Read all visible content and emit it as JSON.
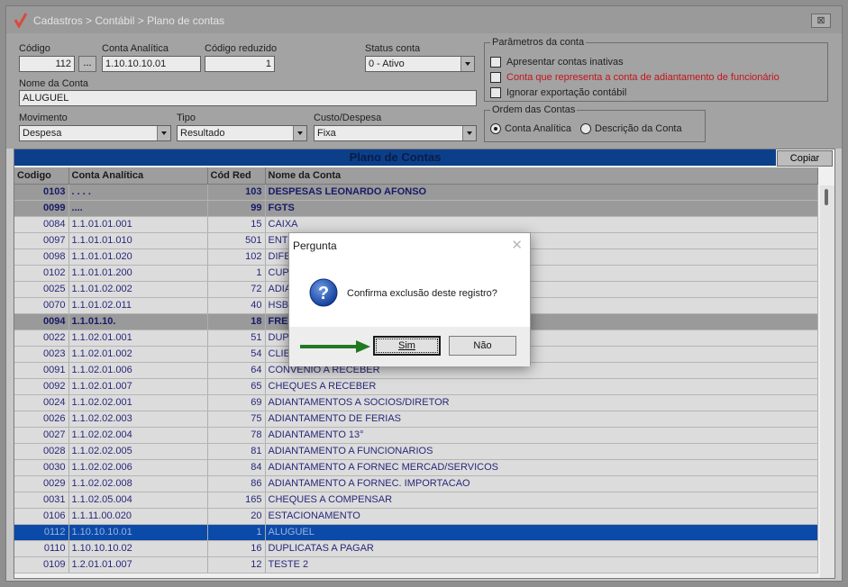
{
  "window": {
    "breadcrumb": "Cadastros > Contábil > Plano de contas",
    "close_label": "⊠"
  },
  "form": {
    "codigo_label": "Código",
    "codigo_value": "112",
    "dots_label": "...",
    "conta_analitica_label": "Conta Analítica",
    "conta_analitica_value": "1.10.10.10.01",
    "codigo_reduzido_label": "Código reduzido",
    "codigo_reduzido_value": "1",
    "status_label": "Status conta",
    "status_value": "0 - Ativo",
    "nome_label": "Nome da Conta",
    "nome_value": "ALUGUEL",
    "movimento_label": "Movimento",
    "movimento_value": "Despesa",
    "tipo_label": "Tipo",
    "tipo_value": "Resultado",
    "custo_label": "Custo/Despesa",
    "custo_value": "Fixa"
  },
  "parametros": {
    "title": "Parâmetros da conta",
    "opt1": "Apresentar contas inativas",
    "opt2": "Conta que representa a conta de adiantamento de funcionário",
    "opt3": "Ignorar exportação contábil"
  },
  "ordem": {
    "title": "Ordem das Contas",
    "opt1": "Conta Analítica",
    "opt2": "Descrição da Conta"
  },
  "grid": {
    "title": "Plano de Contas",
    "copy_label": "Copiar",
    "headers": [
      "Codigo",
      "Conta Analítica",
      "Cód Red",
      "Nome da Conta"
    ],
    "rows": [
      {
        "c": "0103",
        "a": ". . . .",
        "r": "103",
        "n": "DESPESAS LEONARDO AFONSO",
        "t": "grp"
      },
      {
        "c": "0099",
        "a": "....",
        "r": "99",
        "n": "FGTS",
        "t": "grp"
      },
      {
        "c": "0084",
        "a": "1.1.01.01.001",
        "r": "15",
        "n": "CAIXA",
        "t": ""
      },
      {
        "c": "0097",
        "a": "1.1.01.01.010",
        "r": "501",
        "n": "ENT",
        "t": ""
      },
      {
        "c": "0098",
        "a": "1.1.01.01.020",
        "r": "102",
        "n": "DIFE",
        "t": ""
      },
      {
        "c": "0102",
        "a": "1.1.01.01.200",
        "r": "1",
        "n": "CUP",
        "t": ""
      },
      {
        "c": "0025",
        "a": "1.1.01.02.002",
        "r": "72",
        "n": "ADIA",
        "t": ""
      },
      {
        "c": "0070",
        "a": "1.1.01.02.011",
        "r": "40",
        "n": "HSB",
        "t": ""
      },
      {
        "c": "0094",
        "a": "1.1.01.10.",
        "r": "18",
        "n": "FRE",
        "t": "grp"
      },
      {
        "c": "0022",
        "a": "1.1.02.01.001",
        "r": "51",
        "n": "DUP",
        "t": ""
      },
      {
        "c": "0023",
        "a": "1.1.02.01.002",
        "r": "54",
        "n": "CLIE",
        "t": ""
      },
      {
        "c": "0091",
        "a": "1.1.02.01.006",
        "r": "64",
        "n": "CONVENIO A RECEBER",
        "t": ""
      },
      {
        "c": "0092",
        "a": "1.1.02.01.007",
        "r": "65",
        "n": "CHEQUES A RECEBER",
        "t": ""
      },
      {
        "c": "0024",
        "a": "1.1.02.02.001",
        "r": "69",
        "n": "ADIANTAMENTOS A SOCIOS/DIRETOR",
        "t": ""
      },
      {
        "c": "0026",
        "a": "1.1.02.02.003",
        "r": "75",
        "n": "ADIANTAMENTO DE FERIAS",
        "t": ""
      },
      {
        "c": "0027",
        "a": "1.1.02.02.004",
        "r": "78",
        "n": "ADIANTAMENTO 13°",
        "t": ""
      },
      {
        "c": "0028",
        "a": "1.1.02.02.005",
        "r": "81",
        "n": "ADIANTAMENTO A FUNCIONARIOS",
        "t": ""
      },
      {
        "c": "0030",
        "a": "1.1.02.02.006",
        "r": "84",
        "n": "ADIANTAMENTO A FORNEC MERCAD/SERVICOS",
        "t": ""
      },
      {
        "c": "0029",
        "a": "1.1.02.02.008",
        "r": "86",
        "n": "ADIANTAMENTO A FORNEC. IMPORTACAO",
        "t": ""
      },
      {
        "c": "0031",
        "a": "1.1.02.05.004",
        "r": "165",
        "n": "CHEQUES A COMPENSAR",
        "t": ""
      },
      {
        "c": "0106",
        "a": "1.1.11.00.020",
        "r": "20",
        "n": "ESTACIONAMENTO",
        "t": ""
      },
      {
        "c": "0112",
        "a": "1.10.10.10.01",
        "r": "1",
        "n": "ALUGUEL",
        "t": "sel"
      },
      {
        "c": "0110",
        "a": "1.10.10.10.02",
        "r": "16",
        "n": "DUPLICATAS A PAGAR",
        "t": ""
      },
      {
        "c": "0109",
        "a": "1.2.01.01.007",
        "r": "12",
        "n": "TESTE 2",
        "t": ""
      }
    ]
  },
  "dialog": {
    "title": "Pergunta",
    "close_label": "✕",
    "message": "Confirma exclusão deste registro?",
    "yes_label": "Sim",
    "no_label": "Não",
    "arrow_color": "#1f7a1f"
  }
}
